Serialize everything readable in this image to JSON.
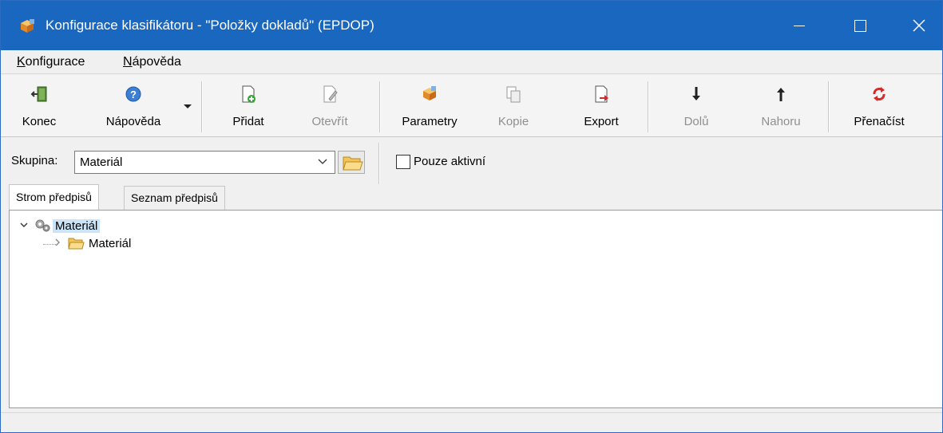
{
  "window": {
    "title": "Konfigurace klasifikátoru - \"Položky dokladů\" (EPDOP)",
    "controls": {
      "minimize": "—",
      "maximize": "☐",
      "close": "✕"
    },
    "accent_color": "#1a67c0"
  },
  "menu": {
    "items": [
      {
        "underline": "K",
        "rest": "onfigurace"
      },
      {
        "underline": "N",
        "rest": "ápověda"
      }
    ]
  },
  "toolbar": {
    "buttons": [
      {
        "label": "Konec",
        "icon": "exit-door-icon",
        "enabled": true
      },
      {
        "label": "Nápověda",
        "icon": "help-icon",
        "enabled": true,
        "has_dropdown": true
      },
      {
        "label": "Přidat",
        "icon": "add-document-icon",
        "enabled": true
      },
      {
        "label": "Otevřít",
        "icon": "edit-document-icon",
        "enabled": false
      },
      {
        "label": "Parametry",
        "icon": "parameters-cubes-icon",
        "enabled": true
      },
      {
        "label": "Kopie",
        "icon": "copy-icon",
        "enabled": false
      },
      {
        "label": "Export",
        "icon": "export-icon",
        "enabled": true
      },
      {
        "label": "Dolů",
        "icon": "arrow-down-icon",
        "enabled": false
      },
      {
        "label": "Nahoru",
        "icon": "arrow-up-icon",
        "enabled": false
      },
      {
        "label": "Přenačíst",
        "icon": "reload-icon",
        "enabled": true
      }
    ]
  },
  "filter": {
    "group_label": "Skupina:",
    "group_value": "Materiál",
    "only_active_label": "Pouze aktivní",
    "only_active_checked": false
  },
  "tabs": [
    {
      "label": "Strom předpisů",
      "active": true
    },
    {
      "label": "Seznam předpisů",
      "active": false
    }
  ],
  "tree": {
    "root": {
      "label": "Materiál",
      "expanded": true,
      "selected": true,
      "icon": "gears-icon"
    },
    "children": [
      {
        "label": "Materiál",
        "expanded": false,
        "icon": "folder-icon"
      }
    ]
  }
}
